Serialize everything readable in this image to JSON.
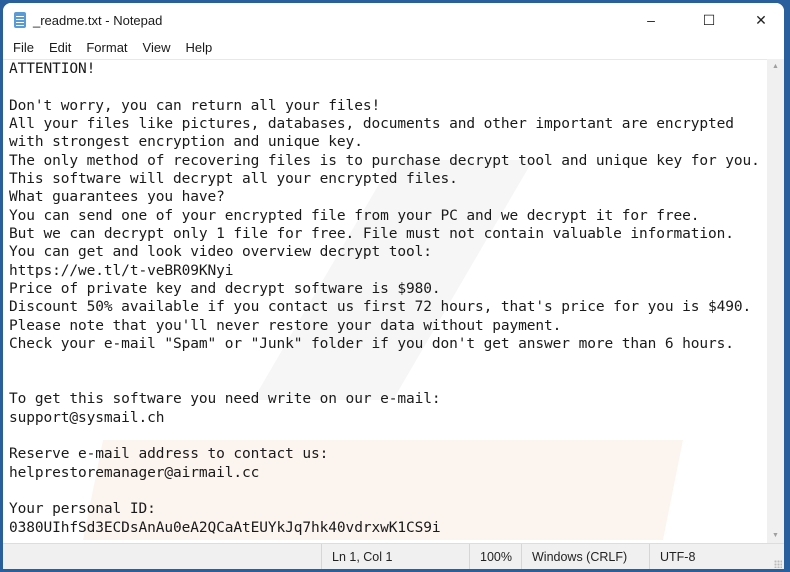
{
  "window": {
    "title": "_readme.txt - Notepad",
    "controls": {
      "minimize": "–",
      "maximize": "☐",
      "close": "✕"
    }
  },
  "menu": [
    "File",
    "Edit",
    "Format",
    "View",
    "Help"
  ],
  "document": {
    "content": "ATTENTION!\n\nDon't worry, you can return all your files!\nAll your files like pictures, databases, documents and other important are encrypted\nwith strongest encryption and unique key.\nThe only method of recovering files is to purchase decrypt tool and unique key for you.\nThis software will decrypt all your encrypted files.\nWhat guarantees you have?\nYou can send one of your encrypted file from your PC and we decrypt it for free.\nBut we can decrypt only 1 file for free. File must not contain valuable information.\nYou can get and look video overview decrypt tool:\nhttps://we.tl/t-veBR09KNyi\nPrice of private key and decrypt software is $980.\nDiscount 50% available if you contact us first 72 hours, that's price for you is $490.\nPlease note that you'll never restore your data without payment.\nCheck your e-mail \"Spam\" or \"Junk\" folder if you don't get answer more than 6 hours.\n\n\nTo get this software you need write on our e-mail:\nsupport@sysmail.ch\n\nReserve e-mail address to contact us:\nhelprestoremanager@airmail.cc\n\nYour personal ID:\n0380UIhfSd3ECDsAnAu0eA2QCaAtEUYkJq7hk40vdrxwK1CS9i"
  },
  "statusbar": {
    "position": "Ln 1, Col 1",
    "zoom": "100%",
    "line_ending": "Windows (CRLF)",
    "encoding": "UTF-8"
  },
  "icons": {
    "scroll_up": "▲",
    "scroll_down": "▼"
  }
}
